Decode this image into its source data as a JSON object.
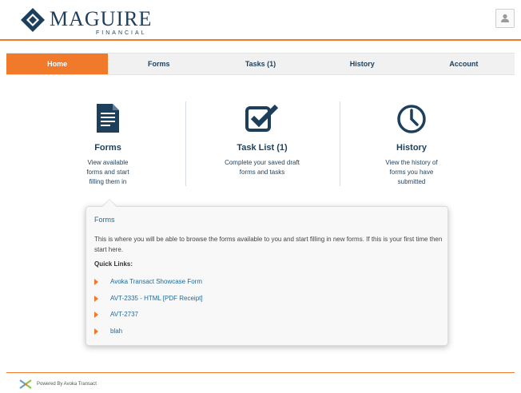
{
  "brand": {
    "name": "MAGUIRE",
    "subtitle": "FINANCIAL",
    "color": "#1d3f5c",
    "accent": "#f07a2a",
    "link": "#1d6a9c"
  },
  "header": {
    "user_icon": "user-icon"
  },
  "nav": {
    "items": [
      {
        "label": "Home",
        "active": true
      },
      {
        "label": "Forms"
      },
      {
        "label": "Tasks (1)"
      },
      {
        "label": "History"
      },
      {
        "label": "Account"
      }
    ]
  },
  "features": [
    {
      "icon": "document-icon",
      "title": "Forms",
      "desc": [
        "View available",
        "forms and start",
        "filling them in"
      ]
    },
    {
      "icon": "checkbox-icon",
      "title": "Task List (1)",
      "desc": [
        "Complete your saved draft",
        "forms and tasks"
      ]
    },
    {
      "icon": "clock-icon",
      "title": "History",
      "desc": [
        "View the history of",
        "forms you have",
        "submitted"
      ]
    }
  ],
  "popup": {
    "title": "Forms",
    "description": "This is where you will be able to browse the forms available to you and start filling in new forms. If this is your first time then start here.",
    "quick_links_label": "Quick Links:",
    "links": [
      "Avoka Transact Showcase Form",
      "AVT-2335 - HTML [PDF Receipt]",
      "AVT-2737",
      "blah"
    ]
  },
  "footer": {
    "text": "Powered By Avoka Transact",
    "icon": "avoka-logo-icon"
  }
}
